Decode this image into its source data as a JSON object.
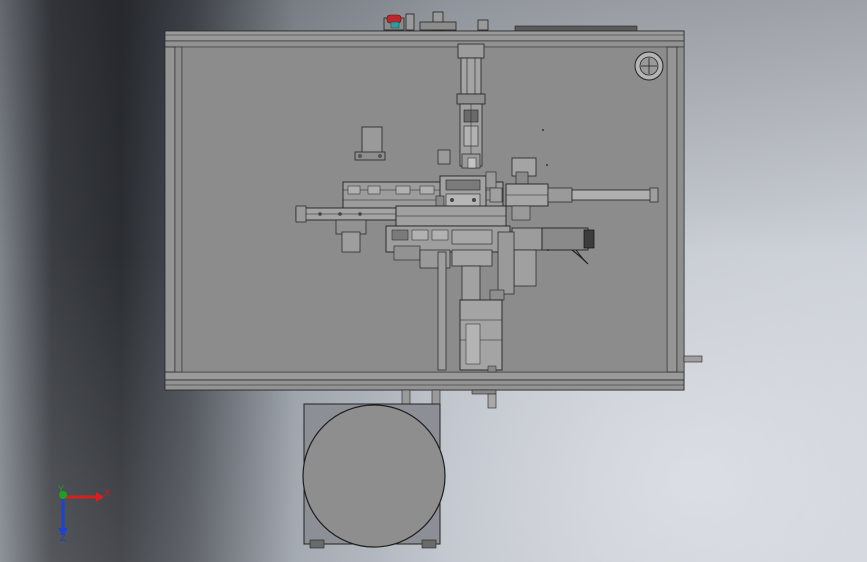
{
  "viewport": {
    "background": "gradient-gray"
  },
  "triad": {
    "x_label": "X",
    "y_label": "Y",
    "z_label": "Z",
    "x_color": "#d42020",
    "y_color": "#20a020",
    "z_color": "#2040d0"
  },
  "colors": {
    "frame_fill": "#8a8a8a",
    "frame_stroke": "#2a2a2a",
    "part_fill": "#9a9a9a",
    "dark_part": "#3c3c3c",
    "red_button": "#c0262b",
    "teal_cap": "#2c9c9c"
  }
}
